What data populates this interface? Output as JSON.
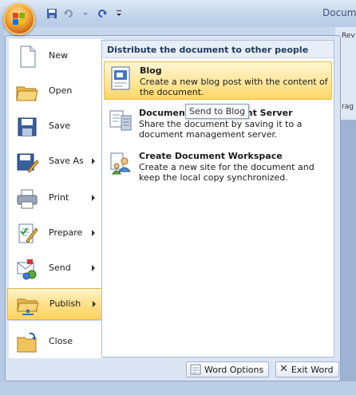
{
  "window": {
    "title_fragment": "Docum"
  },
  "ribbon_fragments": [
    "Rev",
    "rag"
  ],
  "menu": {
    "items": [
      {
        "label": "New",
        "key": "N"
      },
      {
        "label": "Open",
        "key": "O"
      },
      {
        "label": "Save",
        "key": "S"
      },
      {
        "label": "Save As",
        "key": "A"
      },
      {
        "label": "Print",
        "key": "P"
      },
      {
        "label": "Prepare",
        "key": "E"
      },
      {
        "label": "Send",
        "key": "D"
      },
      {
        "label": "Publish",
        "key": "U"
      },
      {
        "label": "Close",
        "key": "C"
      }
    ]
  },
  "submenu": {
    "header": "Distribute the document to other people",
    "options": [
      {
        "title": "Blog",
        "description": "Create a new blog post with the content of the document."
      },
      {
        "title": "Document Management Server",
        "description": "Share the document by saving it to a document management server."
      },
      {
        "title": "Create Document Workspace",
        "description": "Create a new site for the document and keep the local copy synchronized."
      }
    ],
    "tooltip": "Send to Blog"
  },
  "footer": {
    "options_label": "Word Options",
    "exit_label": "Exit Word"
  },
  "colors": {
    "highlight": "#ffe08a",
    "pane_border": "#a9bedb",
    "header_text": "#1e395b"
  }
}
